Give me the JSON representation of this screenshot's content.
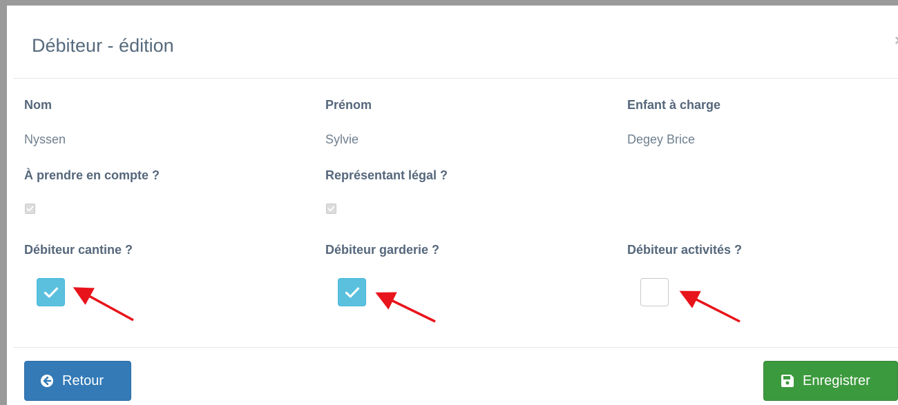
{
  "modal": {
    "title": "Débiteur - édition",
    "close_glyph": "×"
  },
  "fields": {
    "nom": {
      "label": "Nom",
      "value": "Nyssen"
    },
    "prenom": {
      "label": "Prénom",
      "value": "Sylvie"
    },
    "enfant": {
      "label": "Enfant à charge",
      "value": "Degey Brice"
    },
    "a_prendre": {
      "label": "À prendre en compte ?",
      "checked": true,
      "disabled": true
    },
    "representant": {
      "label": "Représentant légal ?",
      "checked": true,
      "disabled": true
    },
    "cantine": {
      "label": "Débiteur cantine ?",
      "checked": true
    },
    "garderie": {
      "label": "Débiteur garderie ?",
      "checked": true
    },
    "activites": {
      "label": "Débiteur activités ?",
      "checked": false
    }
  },
  "buttons": {
    "back": {
      "label": "Retour",
      "icon": "circle-arrow-left-icon"
    },
    "save": {
      "label": "Enregistrer",
      "icon": "floppy-disk-icon"
    }
  },
  "colors": {
    "checkbox_checked": "#5bc0de",
    "back_button": "#337ab7",
    "save_button": "#3c9a3e",
    "annotation_arrow": "#e8141b"
  },
  "annotations": {
    "arrow_icon": "red-arrow-icon"
  }
}
